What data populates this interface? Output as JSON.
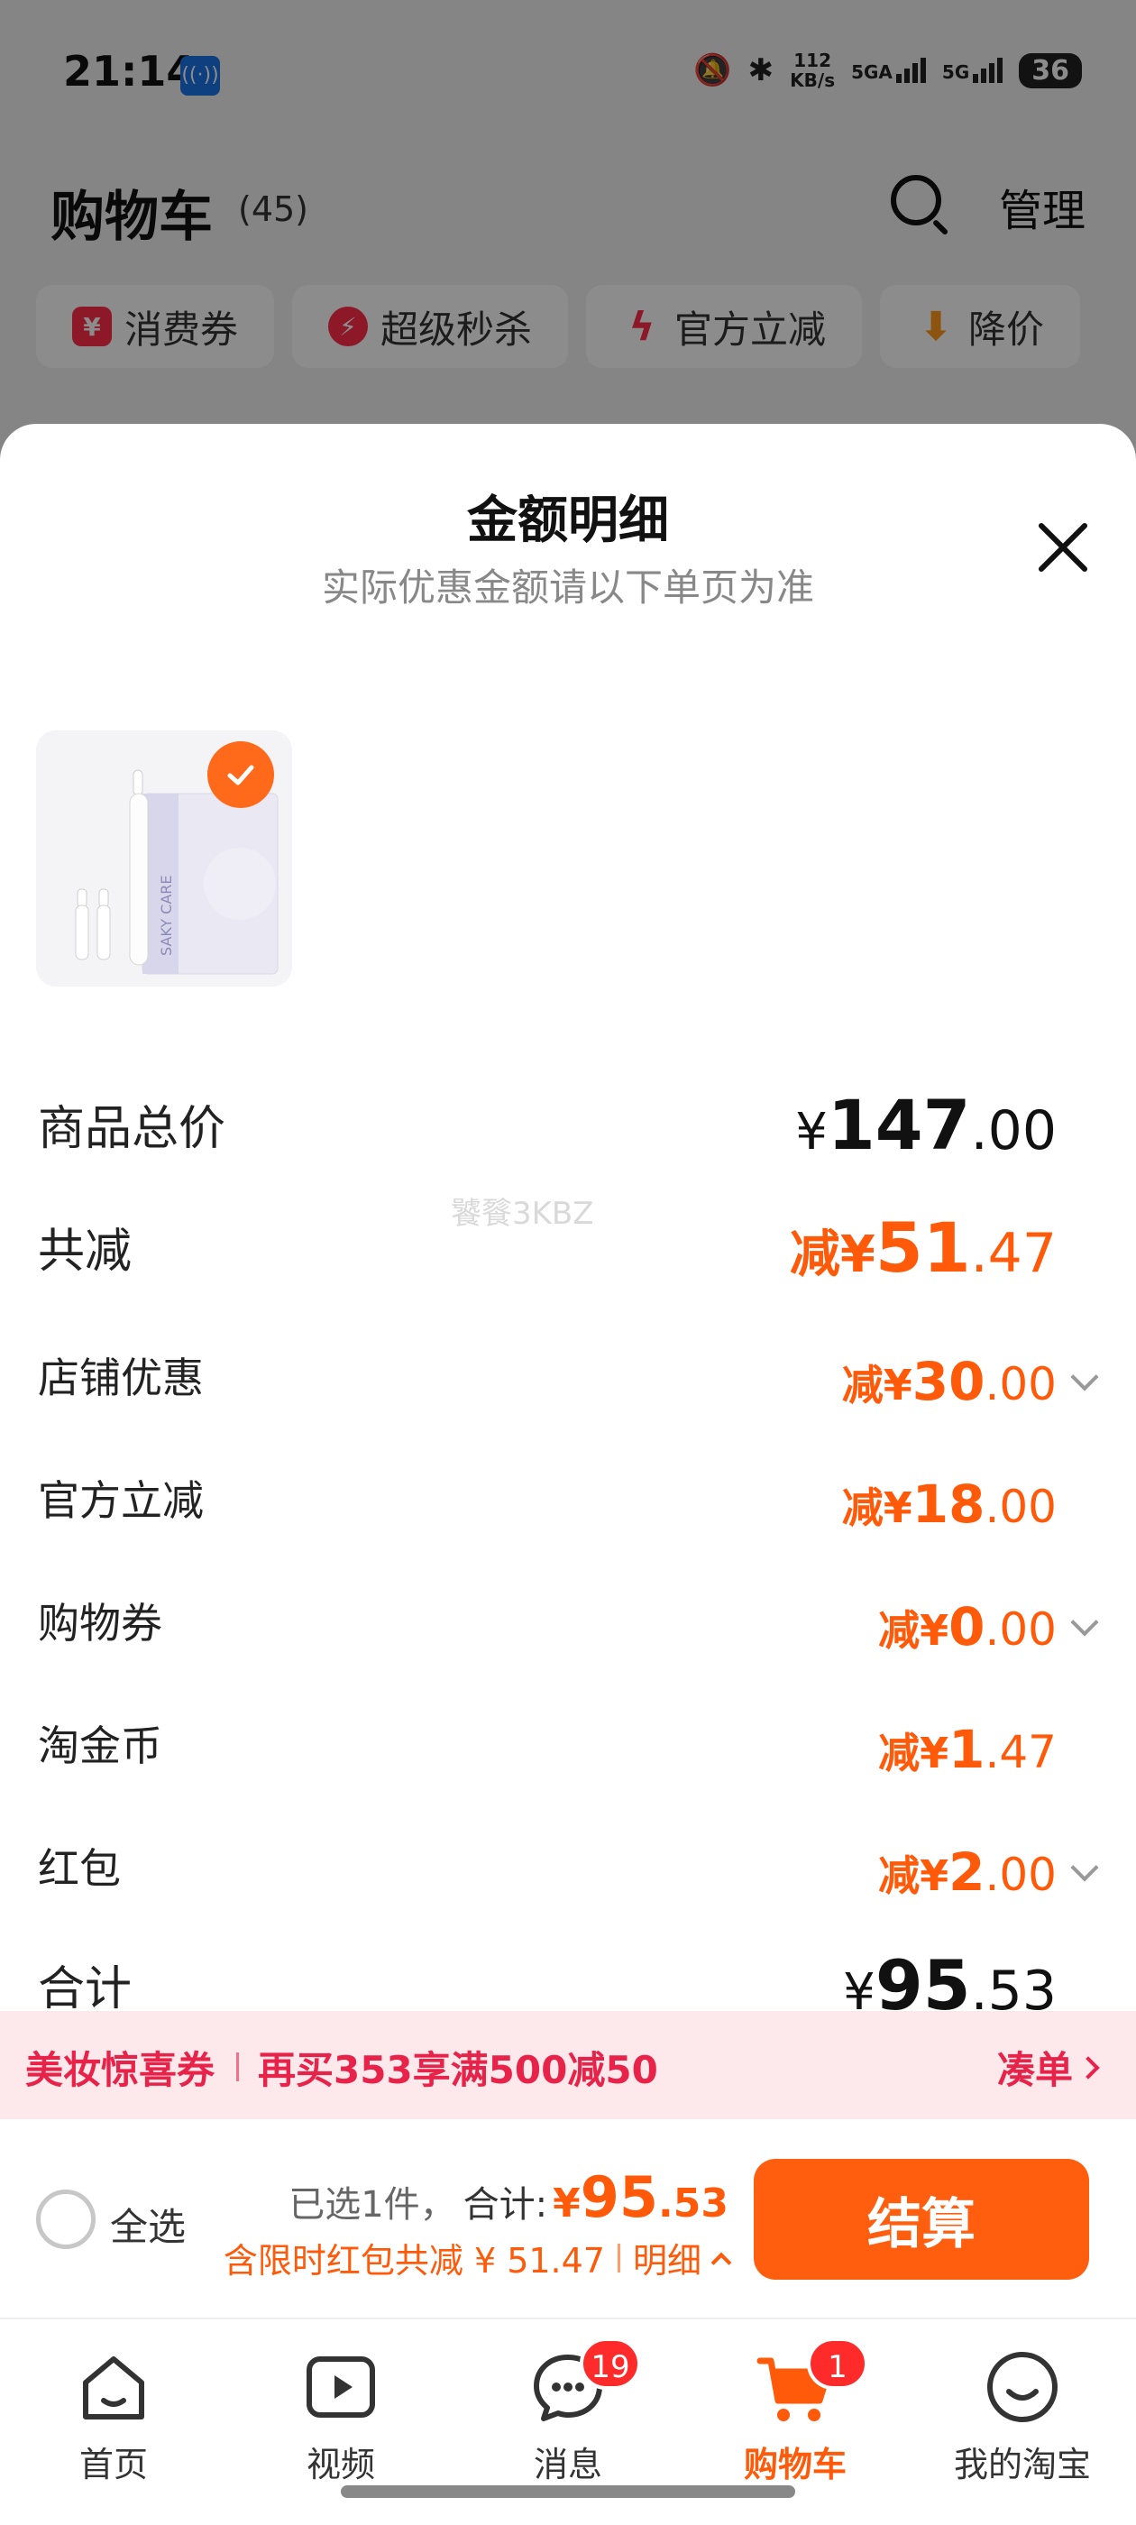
{
  "status_bar": {
    "time": "21:14",
    "hotspot_icon": "hotspot-icon",
    "net_speed_value": "112",
    "net_speed_unit": "KB/s",
    "sim1": "5GA",
    "sim2": "5G",
    "battery": "36"
  },
  "cart": {
    "title": "购物车",
    "count": "(45)",
    "manage_label": "管理",
    "promo_chips": [
      {
        "label": "消费券",
        "icon": "coupon-icon",
        "color": "#ff2d4a"
      },
      {
        "label": "超级秒杀",
        "icon": "flash-sale-icon",
        "color": "#ff2d4a"
      },
      {
        "label": "官方立减",
        "icon": "lightning-icon",
        "color": "#ff2d4a"
      },
      {
        "label": "降价",
        "icon": "price-drop-icon",
        "color": "#ff9a1a"
      }
    ]
  },
  "sheet": {
    "title": "金额明细",
    "subtitle": "实际优惠金额请以下单页为准",
    "product_image_text": "SAKY CARE",
    "rows": [
      {
        "label": "商品总价",
        "prefix": "",
        "currency": "¥",
        "int": "147",
        "dec": ".00",
        "expandable": false
      },
      {
        "label": "共减",
        "prefix": "减",
        "currency": "¥",
        "int": "51",
        "dec": ".47",
        "expandable": false
      },
      {
        "label": "店铺优惠",
        "prefix": "减",
        "currency": "¥",
        "int": "30",
        "dec": ".00",
        "expandable": true
      },
      {
        "label": "官方立减",
        "prefix": "减",
        "currency": "¥",
        "int": "18",
        "dec": ".00",
        "expandable": false
      },
      {
        "label": "购物券",
        "prefix": "减",
        "currency": "¥",
        "int": "0",
        "dec": ".00",
        "expandable": true
      },
      {
        "label": "淘金币",
        "prefix": "减",
        "currency": "¥",
        "int": "1",
        "dec": ".47",
        "expandable": false
      },
      {
        "label": "红包",
        "prefix": "减",
        "currency": "¥",
        "int": "2",
        "dec": ".00",
        "expandable": true
      },
      {
        "label": "合计",
        "prefix": "",
        "currency": "¥",
        "int": "95",
        "dec": ".53",
        "expandable": false
      }
    ],
    "watermark": "饕餮3KBZ"
  },
  "banner": {
    "tag": "美妆惊喜券",
    "text": "再买353享满500减50",
    "action": "凑单"
  },
  "checkout": {
    "select_all": "全选",
    "selected": "已选1件，",
    "total_label": "合计:",
    "total_currency": "¥",
    "total_int": "95",
    "total_dec": ".53",
    "discount_text": "含限时红包共减 ¥ 51.47",
    "detail_label": "明细",
    "button": "结算"
  },
  "tabs": [
    {
      "label": "首页",
      "icon": "home-icon",
      "badge": ""
    },
    {
      "label": "视频",
      "icon": "video-icon",
      "badge": ""
    },
    {
      "label": "消息",
      "icon": "message-icon",
      "badge": "19"
    },
    {
      "label": "购物车",
      "icon": "cart-icon",
      "badge": "1"
    },
    {
      "label": "我的淘宝",
      "icon": "profile-icon",
      "badge": ""
    }
  ],
  "colors": {
    "accent": "#ff5a0a",
    "banner_text": "#e8234a",
    "badge": "#ff2a2a"
  }
}
